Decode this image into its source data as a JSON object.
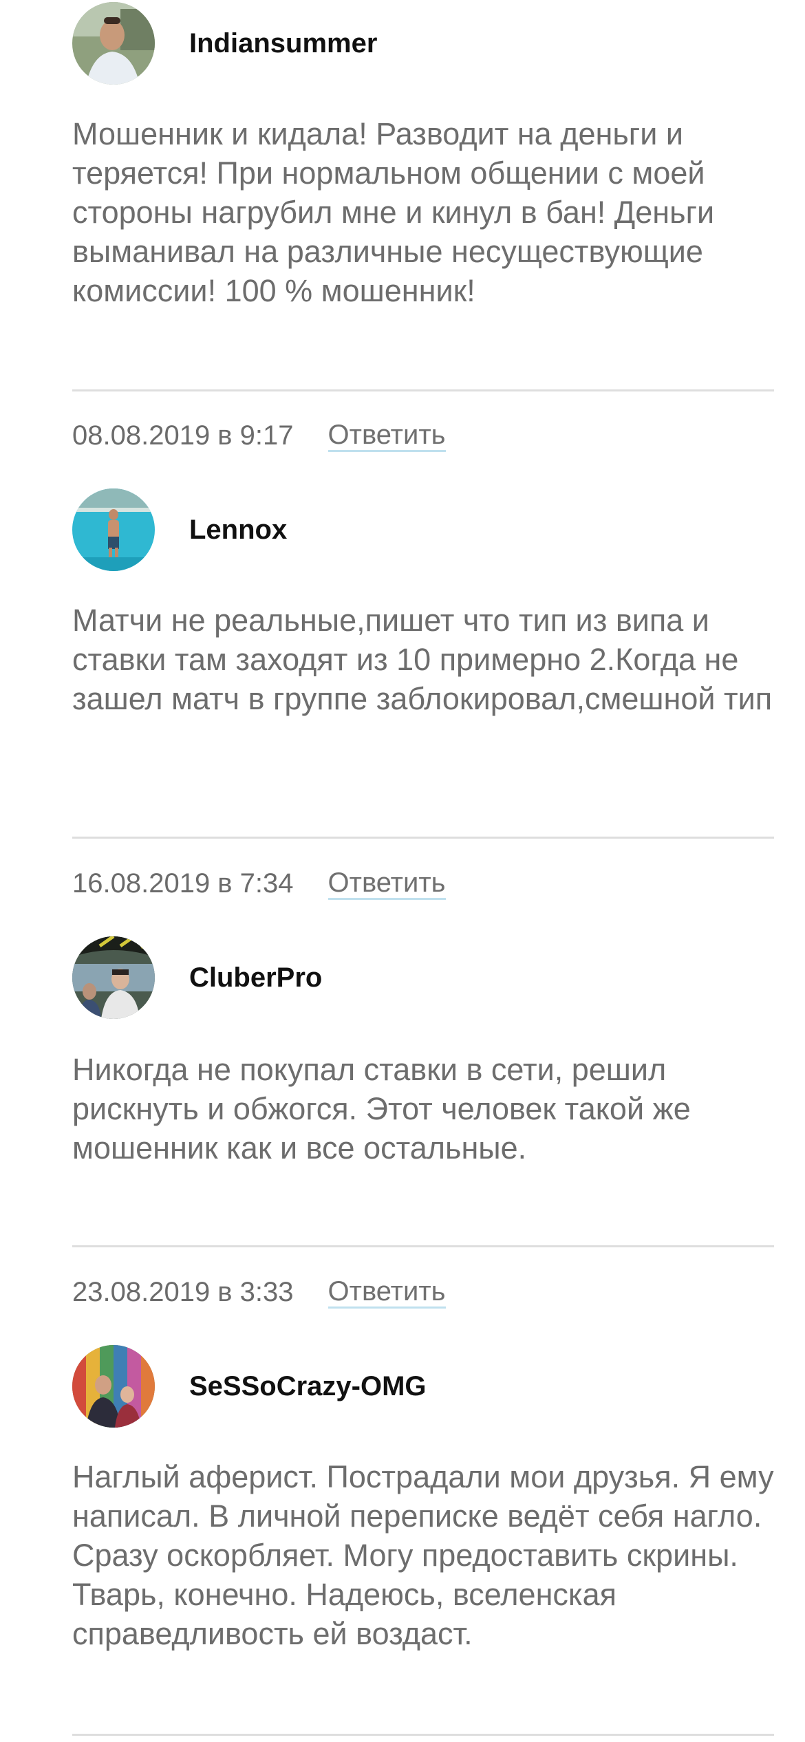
{
  "comments": [
    {
      "author": "Indiansummer",
      "text": "Мошенник и кидала! Разводит на деньги и теряется! При нормальном общении с моей стороны нагрубил мне и кинул в бан! Деньги выманивал на различные несуществующие комиссии! 100 % мошенник!",
      "avatar_icon": "user-photo-avatar"
    },
    {
      "date": "08.08.2019 в 9:17",
      "reply_label": "Ответить",
      "author": "Lennox",
      "text": "Матчи не реальные,пишет что тип из випа и ставки там заходят из 10 примерно 2.Когда не зашел матч в группе заблокировал,смешной тип",
      "avatar_icon": "user-photo-avatar"
    },
    {
      "date": "16.08.2019 в 7:34",
      "reply_label": "Ответить",
      "author": "CluberPro",
      "text": "Никогда не покупал ставки в сети, решил рискнуть и обжогся. Этот человек такой же мошенник как и все остальные.",
      "avatar_icon": "user-photo-avatar"
    },
    {
      "date": "23.08.2019 в 3:33",
      "reply_label": "Ответить",
      "author": "SeSSoCrazy-OMG",
      "text": "Наглый аферист. Пострадали мои друзья. Я ему написал. В личной переписке ведёт себя нагло. Сразу оскорбляет. Могу предоставить скрины. Тварь, конечно. Надеюсь, вселенская справедливость ей воздаст.",
      "avatar_icon": "user-photo-avatar"
    }
  ],
  "colors": {
    "text_gray": "#6d6d6d",
    "author": "#111111",
    "divider": "#dedede",
    "reply_underline": "#bfe0ee"
  }
}
